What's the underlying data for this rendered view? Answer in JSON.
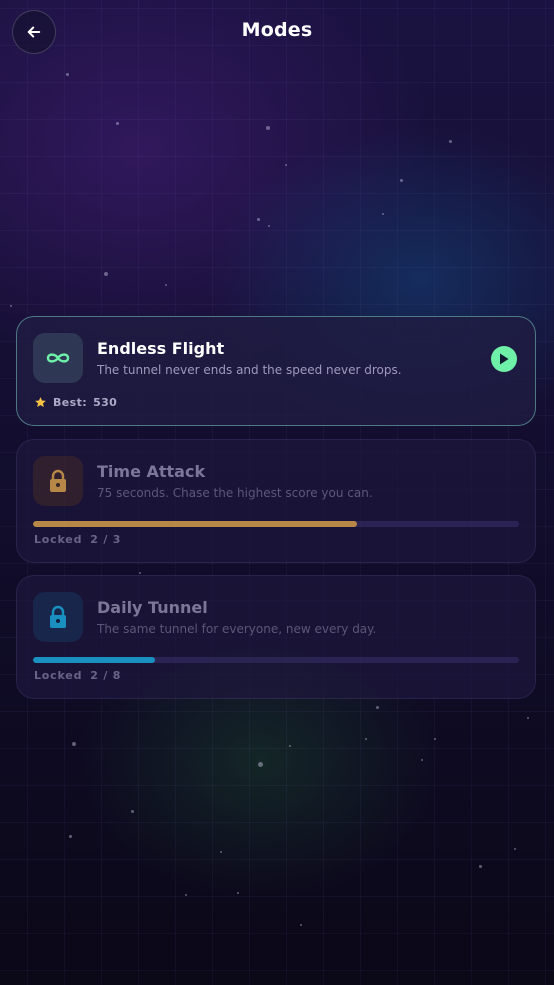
{
  "header": {
    "title": "Modes"
  },
  "modes": [
    {
      "title": "Endless Flight",
      "description": "The tunnel never ends and the speed never drops.",
      "best_label": "Best:",
      "best_value": "530",
      "state": "unlocked",
      "accent": "#6ff0a8"
    },
    {
      "title": "Time Attack",
      "description": "75 seconds. Chase the highest score you can.",
      "status": "Locked",
      "progress_text": "2 / 3",
      "progress_fraction": 0.667,
      "state": "locked",
      "accent": "#c9954a"
    },
    {
      "title": "Daily Tunnel",
      "description": "The same tunnel for everyone, new every day.",
      "status": "Locked",
      "progress_text": "2 / 8",
      "progress_fraction": 0.25,
      "state": "locked",
      "accent": "#1b9fd0"
    }
  ],
  "icons": {
    "back": "arrow-left-icon",
    "endless": "infinity-icon",
    "locked": "lock-icon",
    "play": "play-icon",
    "best": "star-icon"
  }
}
